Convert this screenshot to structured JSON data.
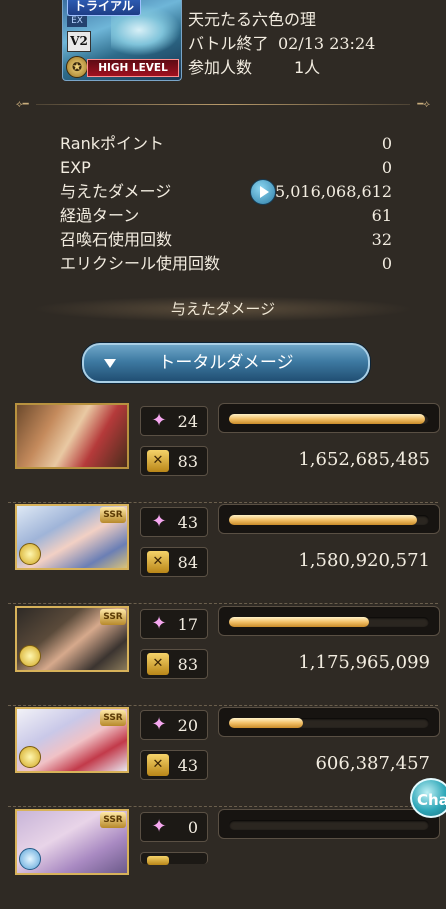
{
  "quest": {
    "badge_trial": "トライアル",
    "badge_ex": "EX",
    "badge_v2": "V2",
    "badge_level": "HIGH LEVEL",
    "title": "天元たる六色の理",
    "battle_end_label": "バトル終了",
    "battle_end_time": "02/13 23:24",
    "participants_label": "参加人数",
    "participants_value": "1人"
  },
  "stats": [
    {
      "label": "Rankポイント",
      "value": "0"
    },
    {
      "label": "EXP",
      "value": "0"
    },
    {
      "label": "与えたダメージ",
      "value": "5,016,068,612"
    },
    {
      "label": "経過ターン",
      "value": "61"
    },
    {
      "label": "召喚石使用回数",
      "value": "32"
    },
    {
      "label": "エリクシール使用回数",
      "value": "0"
    }
  ],
  "section_title": "与えたダメージ",
  "total_button": "トータルダメージ",
  "players": [
    {
      "ssr": false,
      "element": "none",
      "count1": "24",
      "count2": "83",
      "bar": 0.98,
      "damage": "1,652,685,485"
    },
    {
      "ssr": true,
      "element": "light",
      "count1": "43",
      "count2": "84",
      "bar": 0.94,
      "damage": "1,580,920,571"
    },
    {
      "ssr": true,
      "element": "light",
      "count1": "17",
      "count2": "83",
      "bar": 0.7,
      "damage": "1,175,965,099"
    },
    {
      "ssr": true,
      "element": "light",
      "count1": "20",
      "count2": "43",
      "bar": 0.37,
      "damage": "606,387,457"
    },
    {
      "ssr": true,
      "element": "water",
      "count1": "0",
      "count2": "",
      "bar": 0.0,
      "damage": ""
    }
  ],
  "ssr_label": "SSR",
  "chat_label": "Cha",
  "icons": {
    "play": "play-icon",
    "sparkle": "sparkle-icon",
    "skull": "skull-icon",
    "element_light": "light-element-icon",
    "element_water": "water-element-icon"
  },
  "colors": {
    "background": "#2f2a24",
    "bar_fill": "#f2c067",
    "button": "#3e7aa2"
  }
}
